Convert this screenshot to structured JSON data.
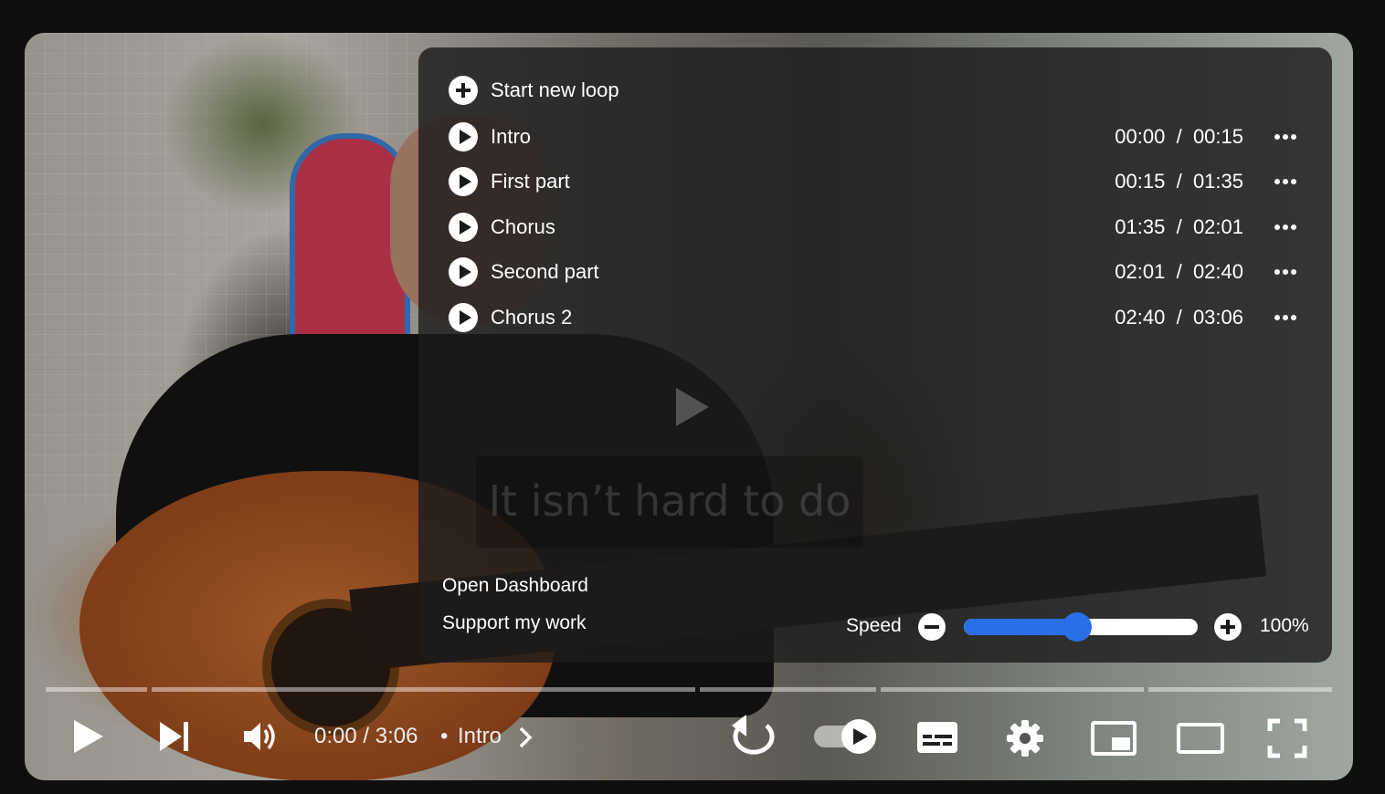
{
  "video": {
    "caption": "It isn’t hard to do"
  },
  "loop_panel": {
    "start_new_loop": "Start new loop",
    "loops": [
      {
        "name": "Intro",
        "start": "00:00",
        "end": "00:15"
      },
      {
        "name": "First part",
        "start": "00:15",
        "end": "01:35"
      },
      {
        "name": "Chorus",
        "start": "01:35",
        "end": "02:01"
      },
      {
        "name": "Second part",
        "start": "02:01",
        "end": "02:40"
      },
      {
        "name": "Chorus 2",
        "start": "02:40",
        "end": "03:06"
      }
    ],
    "time_separator": "/",
    "open_dashboard": "Open Dashboard",
    "support": "Support my work",
    "speed_label": "Speed",
    "speed_value": "100%",
    "speed_fraction": 0.48
  },
  "player": {
    "time": "0:00 / 3:06",
    "chapter_separator": "•",
    "chapter": "Intro",
    "accent_color": "#2a6fe8"
  },
  "icons": [
    "play-icon",
    "next-icon",
    "volume-icon",
    "chevron-right-icon",
    "replay-icon",
    "autoplay-toggle-icon",
    "subtitles-icon",
    "settings-gear-icon",
    "miniplayer-icon",
    "theater-mode-icon",
    "fullscreen-icon"
  ]
}
